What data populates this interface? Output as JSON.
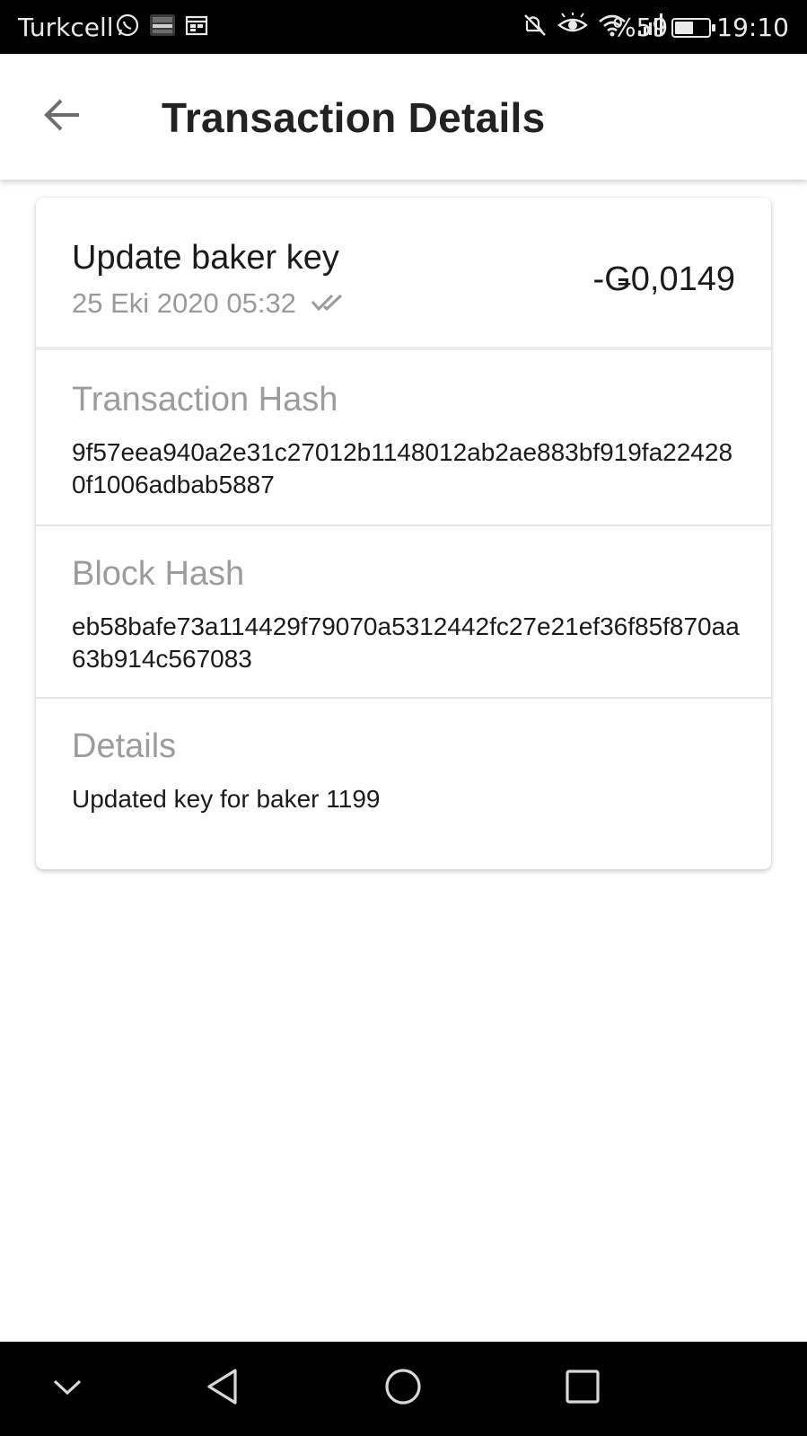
{
  "status_bar": {
    "carrier": "Turkcell",
    "battery_percent": "%59",
    "battery_level": 0.59,
    "time": "19:10",
    "icons": [
      "whatsapp-icon",
      "dergilik-app-icon",
      "calendar-icon",
      "mute-icon",
      "eye-comfort-icon",
      "wifi-icon",
      "signal-icon",
      "battery-icon"
    ]
  },
  "app_bar": {
    "title": "Transaction Details",
    "back_icon": "arrow-back-icon"
  },
  "transaction": {
    "title": "Update baker key",
    "date": "25 Eki 2020 05:32",
    "status_icon": "double-check-icon",
    "amount": "-Ǥ0,0149"
  },
  "sections": {
    "transaction_hash": {
      "label": "Transaction Hash",
      "value": "9f57eea940a2e31c27012b1148012ab2ae883bf919fa224280f1006adbab5887"
    },
    "block_hash": {
      "label": "Block Hash",
      "value": "eb58bafe73a114429f79070a5312442fc27e21ef36f85f870aa63b914c567083"
    },
    "details": {
      "label": "Details",
      "value": "Updated key for baker 1199"
    }
  },
  "nav_bar": {
    "buttons": [
      "chevron-down-icon",
      "back-triangle-icon",
      "home-circle-icon",
      "recents-square-icon"
    ]
  },
  "colors": {
    "status_bar_bg": "#000000",
    "title_text": "#222222",
    "label_gray": "#9c9c9c",
    "divider": "#e6e6e6"
  }
}
